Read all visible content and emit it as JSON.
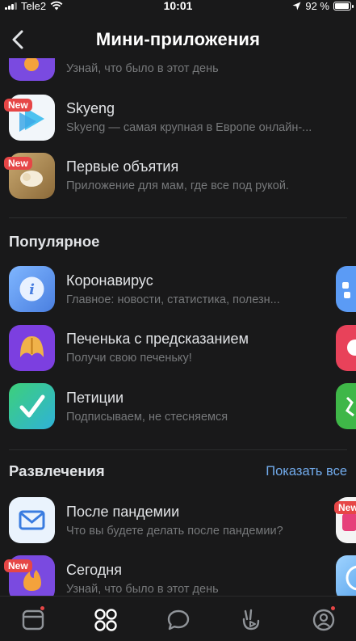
{
  "status_bar": {
    "carrier": "Tele2",
    "time": "10:01",
    "battery": "92 %",
    "battery_level": 0.92
  },
  "header": {
    "title": "Мини-приложения"
  },
  "top_list": [
    {
      "name": "",
      "desc": "Узнай, что было в этот день",
      "badge": ""
    },
    {
      "name": "Skyeng",
      "desc": "Skyeng — самая крупная в Европе онлайн-...",
      "badge": "New"
    },
    {
      "name": "Первые объятия",
      "desc": "Приложение для мам, где все под рукой.",
      "badge": "New"
    }
  ],
  "popular": {
    "title": "Популярное",
    "items": [
      {
        "name": "Коронавирус",
        "desc": "Главное: новости, статистика, полезн...",
        "icon": "info-icon"
      },
      {
        "name": "Печенька с предсказанием",
        "desc": "Получи свою печеньку!",
        "icon": "fortune-cookie-icon"
      },
      {
        "name": "Петиции",
        "desc": "Подписываем, не стесняемся",
        "icon": "checkmark-icon"
      }
    ]
  },
  "entertainment": {
    "title": "Развлечения",
    "show_all": "Показать все",
    "items": [
      {
        "name": "После пандемии",
        "desc": "Что вы будете делать после пандемии?",
        "icon": "envelope-icon",
        "side_badge": "New"
      },
      {
        "name": "Сегодня",
        "desc": "Узнай, что было в этот день",
        "icon": "fire-icon",
        "badge": "New"
      }
    ]
  },
  "tabbar": {
    "items": [
      {
        "name": "news-tab",
        "icon": "newspaper-icon",
        "dot": true
      },
      {
        "name": "services-tab",
        "icon": "grid-icon",
        "active": true
      },
      {
        "name": "messages-tab",
        "icon": "message-bubble-icon"
      },
      {
        "name": "clips-tab",
        "icon": "clips-icon"
      },
      {
        "name": "profile-tab",
        "icon": "profile-icon",
        "dot": true
      }
    ]
  },
  "colors": {
    "background": "#19191a",
    "accent": "#71aaeb",
    "badge": "#e64646",
    "muted": "#76787a"
  }
}
